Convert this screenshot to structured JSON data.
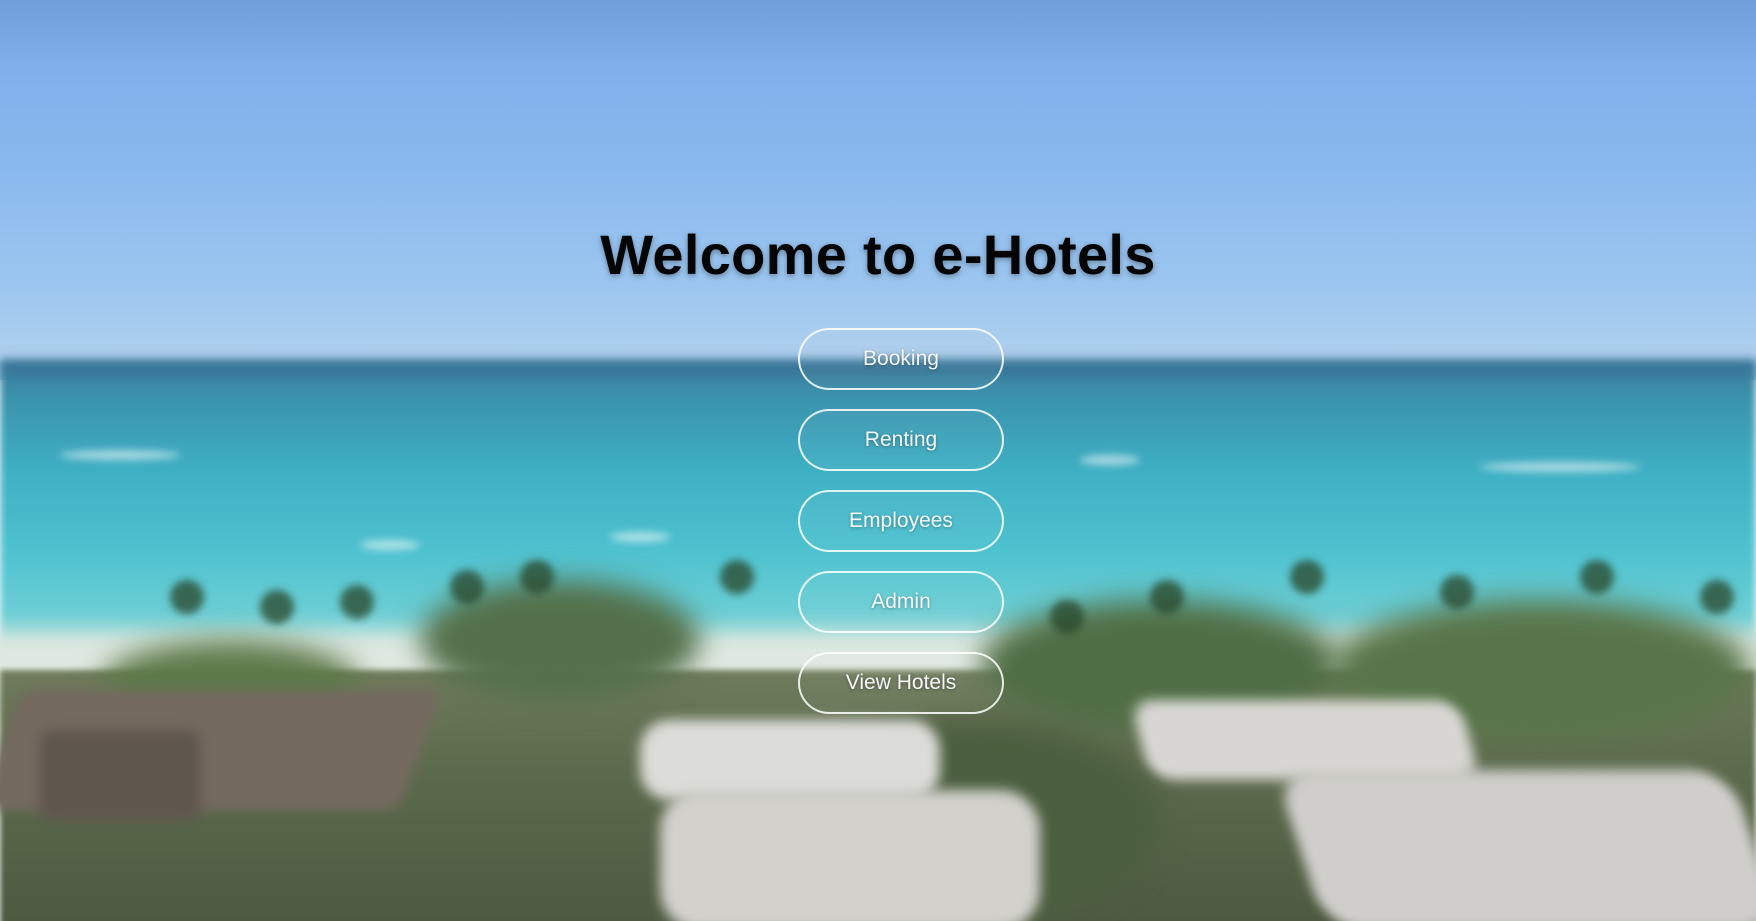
{
  "page": {
    "title": "Welcome to e-Hotels"
  },
  "menu": {
    "buttons": [
      {
        "label": "Booking"
      },
      {
        "label": "Renting"
      },
      {
        "label": "Employees"
      },
      {
        "label": "Admin"
      },
      {
        "label": "View Hotels"
      }
    ]
  },
  "colors": {
    "title": "#050505",
    "button_border": "#ffffff",
    "button_text": "#f4f6f8"
  }
}
